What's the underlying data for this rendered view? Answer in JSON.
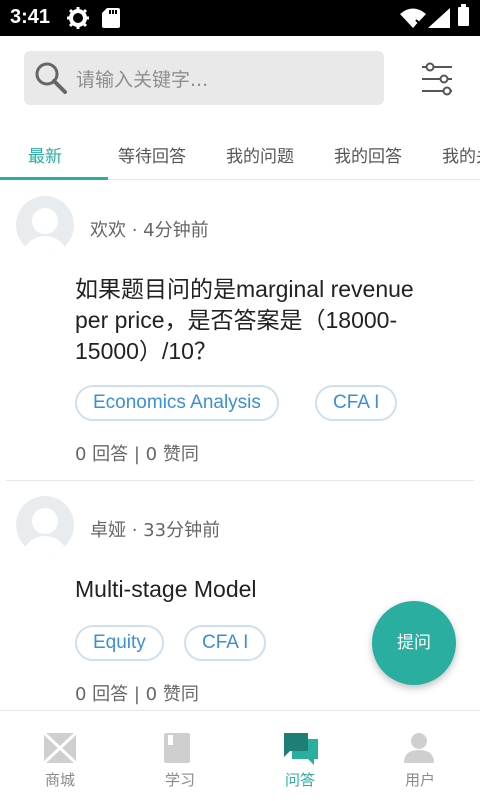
{
  "status_bar": {
    "time": "3:41"
  },
  "search": {
    "placeholder": "请输入关键字..."
  },
  "tabs": [
    {
      "label": "最新",
      "active": true
    },
    {
      "label": "等待回答",
      "active": false
    },
    {
      "label": "我的问题",
      "active": false
    },
    {
      "label": "我的回答",
      "active": false
    },
    {
      "label": "我的关注",
      "active": false
    }
  ],
  "questions": [
    {
      "author": "欢欢 · 4分钟前",
      "title": "如果题目问的是marginal revenue per price，是否答案是（18000-15000）/10？",
      "tags": [
        "Economics Analysis",
        "CFA I"
      ],
      "stats": "0 回答 | 0 赞同"
    },
    {
      "author": "卓娅 · 33分钟前",
      "title": "Multi-stage Model",
      "tags": [
        "Equity",
        "CFA I"
      ],
      "stats": "0 回答 | 0 赞同"
    }
  ],
  "fab": {
    "label": "提问"
  },
  "bottom_nav": [
    {
      "label": "商城",
      "icon": "mail-icon",
      "active": false
    },
    {
      "label": "学习",
      "icon": "book-icon",
      "active": false
    },
    {
      "label": "问答",
      "icon": "chat-icon",
      "active": true
    },
    {
      "label": "用户",
      "icon": "user-icon",
      "active": false
    }
  ],
  "colors": {
    "accent": "#2aaea0",
    "tag_text": "#3a8fd6",
    "inactive": "#8a8a8a"
  }
}
